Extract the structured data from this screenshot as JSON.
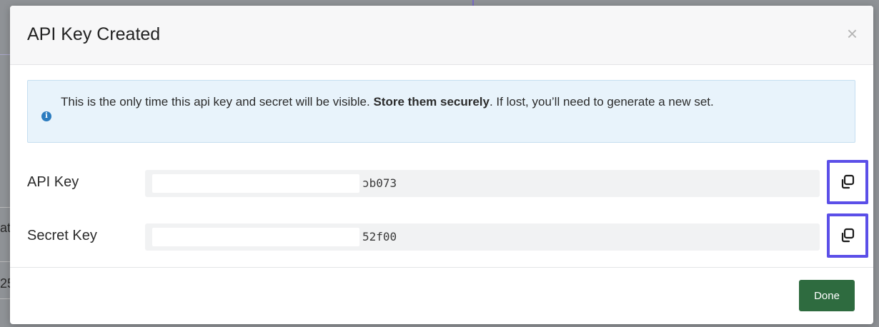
{
  "background": {
    "partial_text_1": "at",
    "partial_text_2": "25"
  },
  "modal": {
    "title": "API Key Created",
    "close_symbol": "×",
    "alert": {
      "icon": "info-icon",
      "text_before": "This is the only time this api key and secret will be visible. ",
      "text_bold": "Store them securely",
      "text_after": ". If lost, you’ll need to generate a new set."
    },
    "api_key": {
      "label": "API Key",
      "visible_suffix": "ɔb073",
      "copy_icon": "copy-icon"
    },
    "secret_key": {
      "label": "Secret Key",
      "visible_suffix": "52f00",
      "copy_icon": "copy-icon"
    },
    "done_label": "Done"
  },
  "colors": {
    "accent_highlight": "#5b4fe8",
    "done_button": "#2e6b3f",
    "alert_bg": "#e8f3fb",
    "info_icon": "#2c7cbf"
  }
}
